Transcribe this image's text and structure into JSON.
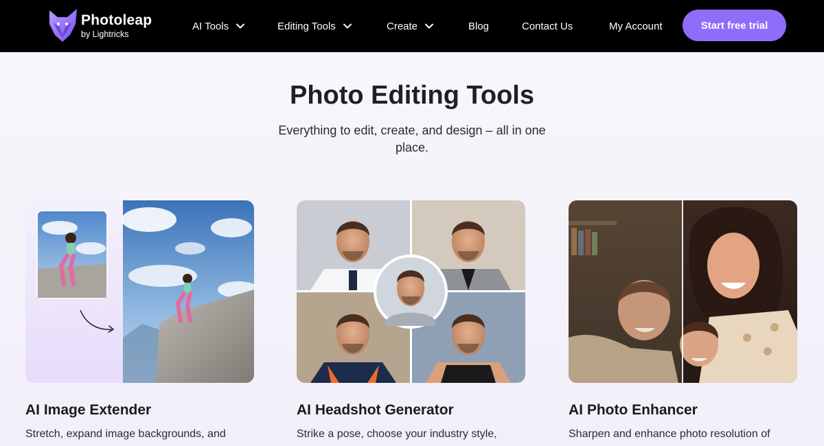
{
  "brand": {
    "name": "Photoleap",
    "sub": "by Lightricks",
    "logo_icon": "fox-logo-icon"
  },
  "nav": {
    "items": [
      {
        "label": "AI Tools",
        "has_dropdown": true
      },
      {
        "label": "Editing Tools",
        "has_dropdown": true
      },
      {
        "label": "Create",
        "has_dropdown": true
      },
      {
        "label": "Blog",
        "has_dropdown": false
      },
      {
        "label": "Contact Us",
        "has_dropdown": false
      },
      {
        "label": "My Account",
        "has_dropdown": false
      }
    ],
    "cta_label": "Start free trial"
  },
  "hero": {
    "title": "Photo Editing Tools",
    "subtitle": "Everything to edit, create, and design – all in one place."
  },
  "cards": [
    {
      "title": "AI Image Extender",
      "description": "Stretch, expand image backgrounds, and"
    },
    {
      "title": "AI Headshot Generator",
      "description": "Strike a pose, choose your industry style,"
    },
    {
      "title": "AI Photo Enhancer",
      "description": "Sharpen and enhance photo resolution of"
    }
  ],
  "colors": {
    "accent": "#8f6df8",
    "navbar": "#000000",
    "background": "#f5f3fb"
  }
}
